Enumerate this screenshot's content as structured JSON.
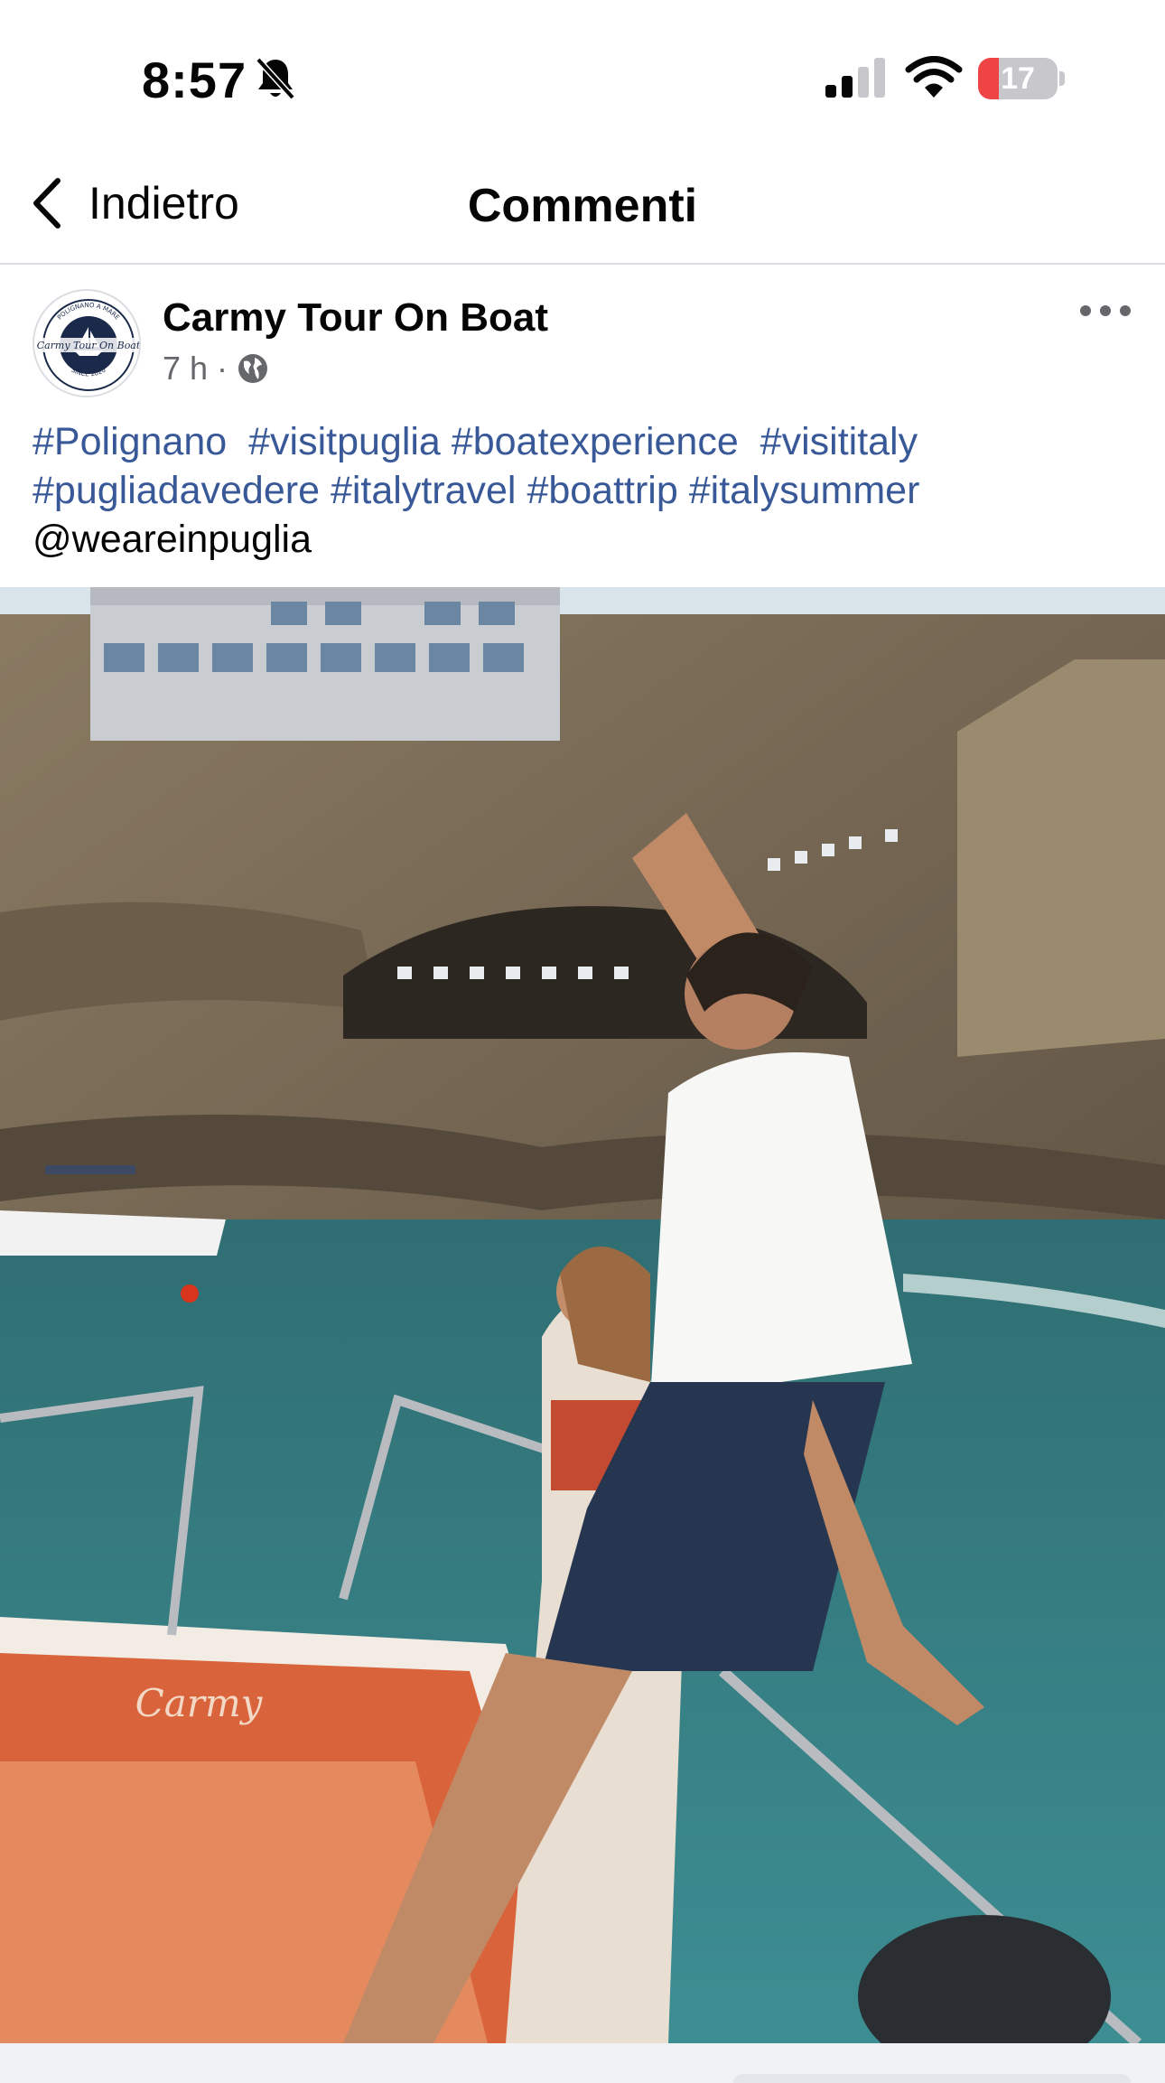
{
  "status_bar": {
    "time": "8:57",
    "battery_level": "17",
    "battery_fraction": 0.17,
    "icons": [
      "bell-slash-icon",
      "cellular-signal-icon",
      "wifi-icon",
      "battery-icon"
    ]
  },
  "nav": {
    "back_label": "Indietro",
    "title": "Commenti"
  },
  "post": {
    "author": "Carmy Tour On Boat",
    "time_ago": "7 h",
    "separator": "·",
    "audience_icon": "globe-icon",
    "more_icon": "more-horizontal-icon",
    "avatar": {
      "arc_top": "POLIGNANO A MARE",
      "center": "Carmy Tour On Boat",
      "arc_bottom": "SINCE 2020"
    },
    "caption": {
      "hashtags": [
        "#Polignano",
        "#visitpuglia",
        "#boatexperience",
        "#visititaly",
        "#pugliadavedere",
        "#italytravel",
        "#boattrip",
        "#italysummer"
      ],
      "mention": "@weareinpuglia"
    },
    "media": {
      "boat_brand": "Carmy"
    }
  },
  "colors": {
    "link": "#385898",
    "secondary_text": "#65676b",
    "divider": "#dadde1",
    "battery_low": "#ef4444"
  }
}
